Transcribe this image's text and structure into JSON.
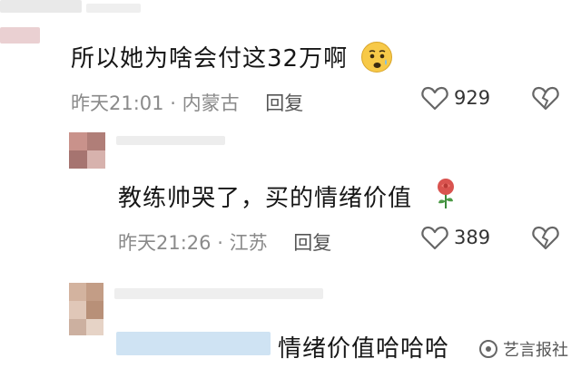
{
  "comments": [
    {
      "text": "所以她为啥会付这32万啊",
      "emoji": "worried-face-emoji",
      "time": "昨天21:01",
      "location": "内蒙古",
      "reply_label": "回复",
      "like_count": "929"
    },
    {
      "text": "教练帅哭了，买的情绪价值",
      "emoji": "rose-emoji",
      "time": "昨天21:26",
      "location": "江苏",
      "reply_label": "回复",
      "like_count": "389"
    },
    {
      "text": "情绪价值哈哈哈"
    }
  ],
  "meta_separator": "·",
  "watermark": {
    "text": "艺言报社",
    "icon": "watermark-logo-icon"
  },
  "colors": {
    "like_icon": "#666666",
    "meta": "#8a8a8a",
    "blur_pink": "#e8a0a6",
    "blur_blue": "#cfe3f3"
  }
}
